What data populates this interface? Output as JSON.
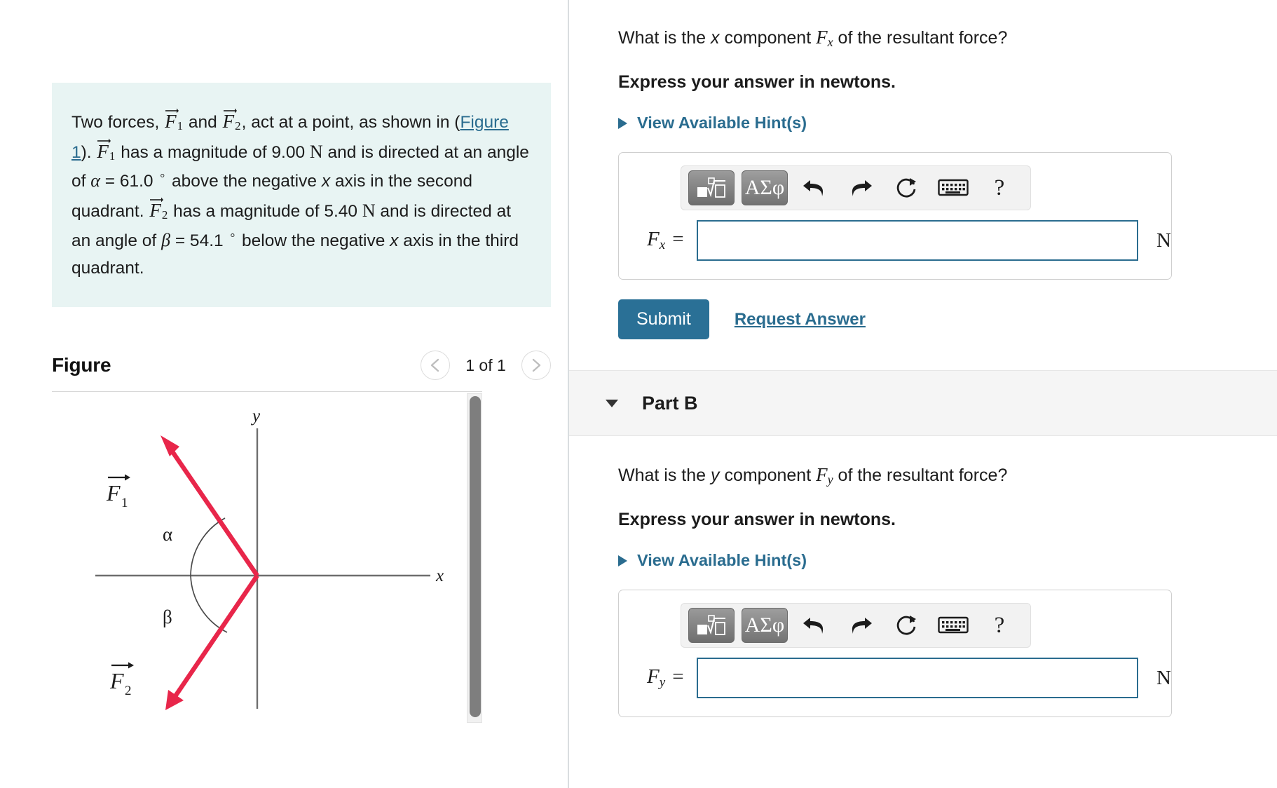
{
  "problem": {
    "line1_a": "Two forces, ",
    "f1": "F",
    "f1_sub": "1",
    "line1_b": " and ",
    "f2": "F",
    "f2_sub": "2",
    "line1_c": ", act at a point, as shown in (",
    "figure_link": "Figure 1",
    "line2_a": "). ",
    "line2_b": " has a magnitude of 9.00 ",
    "newton": "N",
    "line2_c": " and is directed at an angle of ",
    "alpha": "α",
    "alpha_eq": " = 61.0 ",
    "degree": "°",
    "line3_a": " above the negative ",
    "x_italic": "x",
    "line3_b": " axis in the second quadrant. ",
    "line4_a": " has a magnitude of 5.40 ",
    "line4_b": " and is directed at an angle of ",
    "beta": "β",
    "beta_eq": " = 54.1 ",
    "line5": " below the negative ",
    "line5_b": " axis in the third quadrant."
  },
  "figure": {
    "title": "Figure",
    "count_label": "1 of 1",
    "prev_icon": "chevron-left-icon",
    "next_icon": "chevron-right-icon",
    "diagram": {
      "x_axis_label": "x",
      "y_axis_label": "y",
      "alpha_label": "α",
      "beta_label": "β",
      "f1_label": "F",
      "f1_sub": "1",
      "f2_label": "F",
      "f2_sub": "2",
      "vector_color": "#e8264a",
      "axis_color": "#6e6e6e",
      "f1_angle_deg": 61.0,
      "f2_angle_deg": 54.1
    }
  },
  "partA": {
    "question_a": "What is the ",
    "question_x": "x",
    "question_b": " component ",
    "symbol": "F",
    "symbol_sub": "x",
    "question_c": " of the resultant force?",
    "express": "Express your answer in newtons.",
    "hints": "View Available Hint(s)",
    "toolbar": {
      "template_icon": "math-template-icon",
      "greek_label": "ΑΣφ",
      "undo_icon": "undo-arrow-icon",
      "redo_icon": "redo-arrow-icon",
      "reset_icon": "reset-circular-arrow-icon",
      "keyboard_icon": "keyboard-icon",
      "help_label": "?"
    },
    "answer_label": "F",
    "answer_sub": "x",
    "equals": "=",
    "answer_value": "",
    "answer_placeholder": "",
    "unit": "N",
    "submit_label": "Submit",
    "request_label": "Request Answer"
  },
  "partB": {
    "collapse_icon": "triangle-down-icon",
    "title": "Part B",
    "question_a": "What is the ",
    "question_x": "y",
    "question_b": " component ",
    "symbol": "F",
    "symbol_sub": "y",
    "question_c": " of the resultant force?",
    "express": "Express your answer in newtons.",
    "hints": "View Available Hint(s)",
    "toolbar": {
      "template_icon": "math-template-icon",
      "greek_label": "ΑΣφ",
      "undo_icon": "undo-arrow-icon",
      "redo_icon": "redo-arrow-icon",
      "reset_icon": "reset-circular-arrow-icon",
      "keyboard_icon": "keyboard-icon",
      "help_label": "?"
    },
    "answer_label": "F",
    "answer_sub": "y",
    "equals": "=",
    "answer_value": "",
    "unit": "N"
  },
  "colors": {
    "accent": "#2a6c8f",
    "submit": "#2a7096",
    "problem_bg": "#e8f4f3",
    "vector_red": "#e8264a"
  }
}
